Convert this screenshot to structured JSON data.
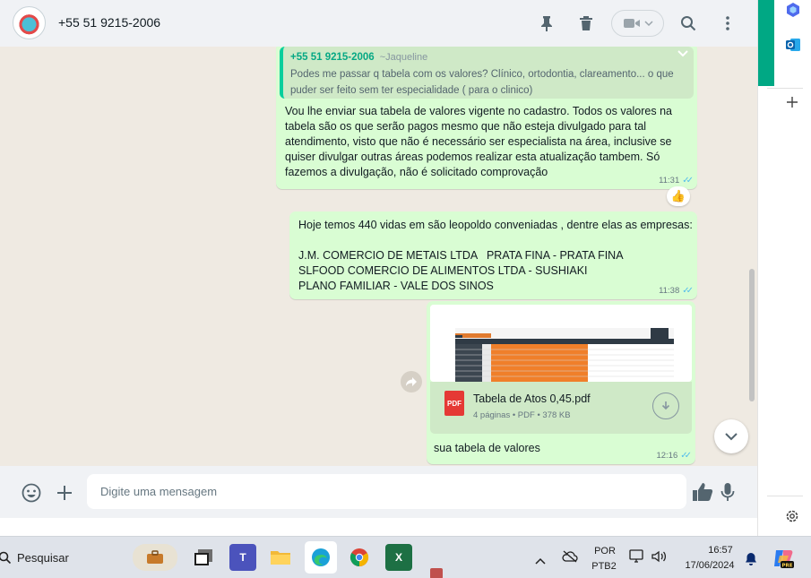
{
  "header": {
    "contact_name": "+55 51 9215-2006"
  },
  "messages": {
    "quote": {
      "name": "+55 51 9215-2006",
      "alias": "~Jaqueline",
      "text": "Podes me passar q tabela com os valores? Clínico, ortodontia, clareamento... o que puder ser feito sem ter especialidade ( para o clinico)"
    },
    "msg1": {
      "text": "Vou lhe enviar sua tabela de valores vigente no cadastro. Todos os valores na tabela são os que serão pagos mesmo que não esteja divulgado para tal atendimento, visto que não é necessário ser especialista na área, inclusive se quiser divulgar outras áreas podemos realizar esta atualização tambem. Só fazemos a divulgação, não é solicitado comprovação",
      "time": "11:31",
      "reaction": "👍"
    },
    "msg2": {
      "text": "Hoje temos 440 vidas em são leopoldo conveniadas , dentre elas as empresas:\n\nJ.M. COMERCIO DE METAIS LTDA   PRATA FINA - PRATA FINA\nSLFOOD COMERCIO DE ALIMENTOS LTDA - SUSHIAKI\nPLANO FAMILIAR - VALE DOS SINOS",
      "time": "11:38"
    },
    "doc": {
      "file_name": "Tabela de Atos 0,45.pdf",
      "meta": "4 páginas • PDF • 378 KB",
      "pdf_label": "PDF",
      "caption": "sua tabela de valores",
      "time": "12:16"
    }
  },
  "composer": {
    "placeholder": "Digite uma mensagem"
  },
  "taskbar": {
    "search_label": "Pesquisar",
    "lang_top": "POR",
    "lang_bottom": "PTB2",
    "time": "16:57",
    "date": "17/06/2024"
  },
  "colors": {
    "bubble_out": "#d9fdd3",
    "accent_green": "#00a884",
    "ticks_blue": "#53bdeb"
  }
}
